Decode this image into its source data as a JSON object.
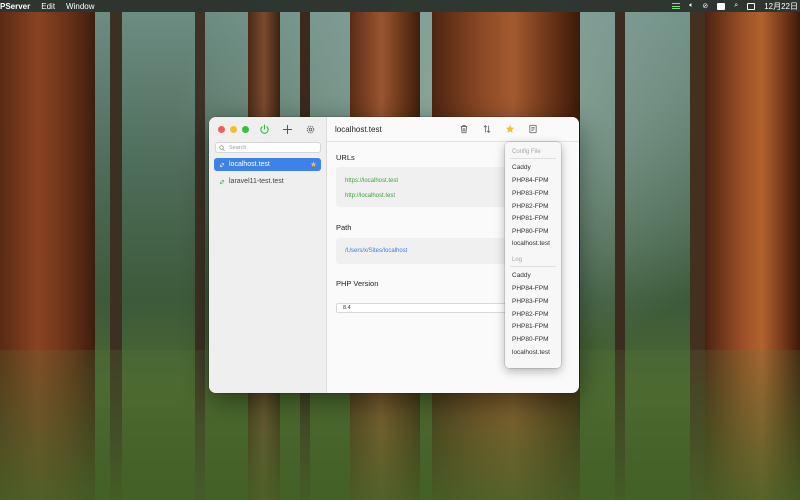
{
  "menubar": {
    "app_name": "PServer",
    "menus": [
      "Edit",
      "Window"
    ],
    "clock": "12月22日"
  },
  "sidebar": {
    "search_placeholder": "Search",
    "sites": [
      {
        "name": "localhost.test",
        "active": true,
        "favorite": true
      },
      {
        "name": "laravel11-test.test",
        "active": false,
        "favorite": false
      }
    ]
  },
  "main": {
    "title": "localhost.test",
    "urls_label": "URLs",
    "urls": [
      "https://localhost.test",
      "http://localhost.test"
    ],
    "path_label": "Path",
    "path": "/Users/x/Sites/localhost",
    "php_label": "PHP Version",
    "php_version": "8.4"
  },
  "dropdown": {
    "config_header": "Config File",
    "config_items": [
      "Caddy",
      "PHP84-FPM",
      "PHP83-FPM",
      "PHP82-FPM",
      "PHP81-FPM",
      "PHP80-FPM",
      "localhost.test"
    ],
    "log_header": "Log",
    "log_items": [
      "Caddy",
      "PHP84-FPM",
      "PHP83-FPM",
      "PHP82-FPM",
      "PHP81-FPM",
      "PHP80-FPM",
      "localhost.test"
    ]
  },
  "colors": {
    "accent": "#3e82e8",
    "url_green": "#3fa33b",
    "path_blue": "#3c7fd6",
    "favorite_star": "#f6c232",
    "power_green": "#2fb84a"
  }
}
